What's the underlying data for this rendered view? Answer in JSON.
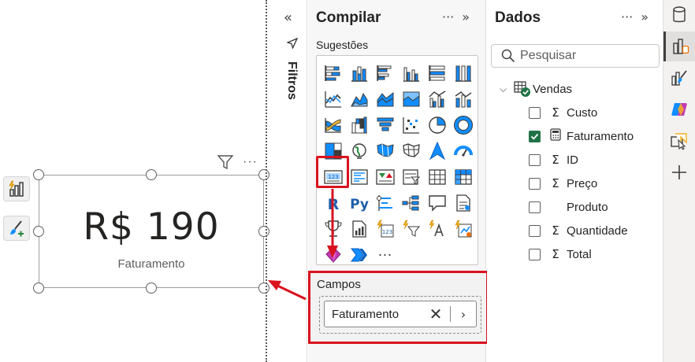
{
  "canvas": {
    "card": {
      "value": "R$ 190",
      "label": "Faturamento"
    },
    "side_buttons": [
      "lightning-bar-chart-icon",
      "paintbrush-icon"
    ],
    "header_icons": [
      "filter-icon",
      "more-options-icon"
    ],
    "more_symbol": "···"
  },
  "filters_pane": {
    "label": "Filtros",
    "expand_symbol": "«"
  },
  "build_pane": {
    "title": "Compilar",
    "more_symbol": "···",
    "collapse_symbol": "»",
    "suggestions_label": "Sugestões",
    "more_visuals_symbol": "···",
    "visuals": [
      "stacked-bar-chart",
      "stacked-column-chart",
      "clustered-bar-chart",
      "clustered-column-chart",
      "100-stacked-bar-chart",
      "100-stacked-column-chart",
      "line-chart",
      "area-chart",
      "stacked-area-chart",
      "100-stacked-area-chart",
      "line-clustered-column-chart",
      "line-stacked-column-chart",
      "ribbon-chart",
      "waterfall-chart",
      "funnel-chart",
      "scatter-chart",
      "pie-chart",
      "donut-chart",
      "treemap",
      "map",
      "filled-map",
      "shape-map",
      "azure-map",
      "gauge",
      "card",
      "multi-row-card",
      "kpi",
      "slicer",
      "table",
      "matrix",
      "r-visual",
      "python-visual",
      "key-influencers",
      "decomposition-tree",
      "qa-visual",
      "narrative",
      "goals",
      "paginated-report",
      "power-apps",
      "power-automate",
      "smart-narrative",
      "metrics",
      "power-bi-visual",
      "arrow-visual"
    ],
    "selected_visual": "card",
    "fields_label": "Campos",
    "field_pill": {
      "label": "Faturamento",
      "remove_symbol": "✕",
      "expand_symbol": "›"
    }
  },
  "data_pane": {
    "title": "Dados",
    "more_symbol": "···",
    "collapse_symbol": "»",
    "search_placeholder": "Pesquisar",
    "table": {
      "name": "Vendas",
      "chevron": "⌵",
      "fields": [
        {
          "name": "Custo",
          "icon": "Σ",
          "checked": false
        },
        {
          "name": "Faturamento",
          "icon": "calculator",
          "checked": true
        },
        {
          "name": "ID",
          "icon": "Σ",
          "checked": false
        },
        {
          "name": "Preço",
          "icon": "Σ",
          "checked": false
        },
        {
          "name": "Produto",
          "icon": "",
          "checked": false
        },
        {
          "name": "Quantidade",
          "icon": "Σ",
          "checked": false
        },
        {
          "name": "Total",
          "icon": "Σ",
          "checked": false
        }
      ]
    }
  },
  "right_rail": [
    "data-cylinder-icon",
    "build-visual-icon",
    "format-brush-icon",
    "copilot-icon",
    "bookmark-select-icon",
    "add-icon"
  ],
  "colors": {
    "highlight_red": "#d9121f",
    "checkbox_green": "#217346",
    "viz_blue": "#118dff",
    "viz_dark": "#3c3c3c"
  }
}
